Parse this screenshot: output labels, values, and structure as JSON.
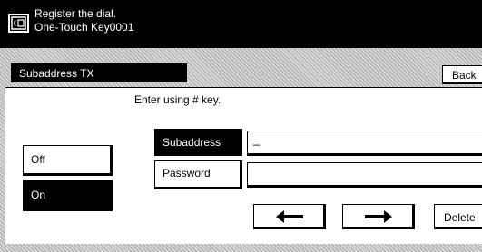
{
  "header": {
    "line1": "Register the dial.",
    "line2": "One-Touch Key0001",
    "icon": "fax-register-icon"
  },
  "panel": {
    "title": "Subaddress TX",
    "back_label": "Back",
    "instruction": "Enter using # key."
  },
  "toggle": {
    "off_label": "Off",
    "on_label": "On",
    "selected": "On"
  },
  "fields": {
    "subaddress_label": "Subaddress",
    "subaddress_value": "_",
    "password_label": "Password",
    "password_value": ""
  },
  "actions": {
    "left_icon": "arrow-left-icon",
    "right_icon": "arrow-right-icon",
    "delete_label": "Delete"
  }
}
